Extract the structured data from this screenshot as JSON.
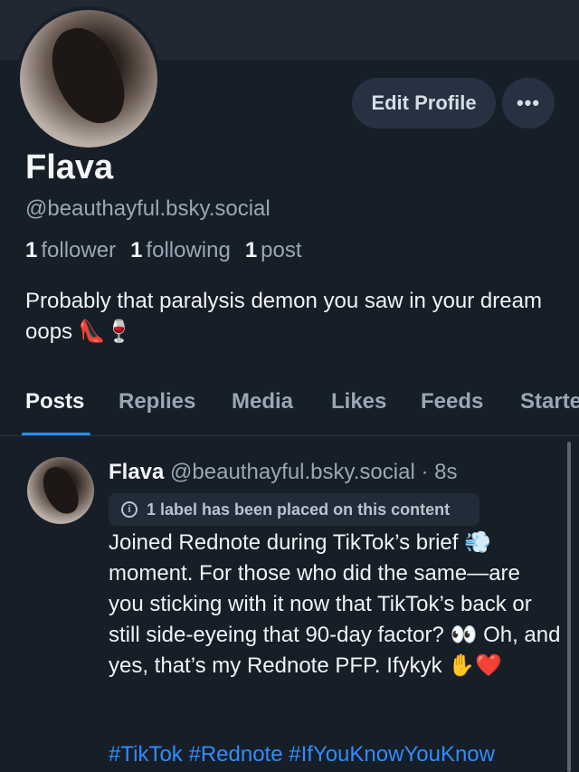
{
  "profile": {
    "display_name": "Flava",
    "handle": "@beauthayful.bsky.social",
    "followers_count": "1",
    "followers_label": "follower",
    "following_count": "1",
    "following_label": "following",
    "posts_count": "1",
    "posts_label": "post",
    "bio": "Probably that paralysis demon you saw in your dream oops 👠🍷"
  },
  "actions": {
    "edit_profile": "Edit Profile",
    "more": "•••"
  },
  "tabs": [
    "Posts",
    "Replies",
    "Media",
    "Likes",
    "Feeds",
    "Starte"
  ],
  "active_tab": "Posts",
  "post": {
    "author_name": "Flava",
    "author_handle": "@beauthayful.bsky.social",
    "separator": "·",
    "time": "8s",
    "label_text": "1 label has been placed on this content",
    "body": "Joined Rednote during TikTok’s brief 💨 moment. For those who did the same—are you sticking with it now that TikTok’s back or still side-eyeing that 90-day factor? 👀 Oh, and yes, that’s my Rednote PFP. Ifykyk ✋❤️",
    "hashtags": "#TikTok #Rednote #IfYouKnowYouKnow"
  },
  "colors": {
    "background": "#161e27",
    "accent": "#2f8cff",
    "muted_text": "#9aa7b5"
  },
  "icons": {
    "info": "info-circle-icon",
    "more": "ellipsis-icon"
  }
}
